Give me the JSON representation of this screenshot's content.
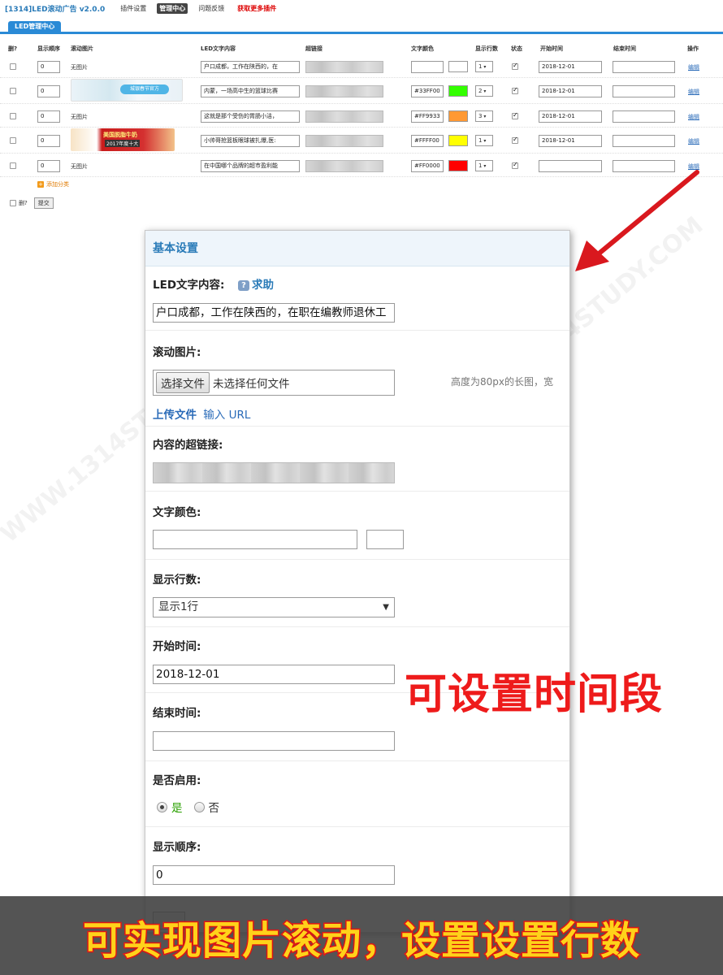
{
  "header": {
    "app_title": "[1314]LED滚动广告 v2.0.0",
    "nav": [
      "插件设置",
      "管理中心",
      "问题反馈",
      "获取更多插件"
    ]
  },
  "tab": {
    "label": "LED管理中心"
  },
  "table": {
    "columns": [
      "删?",
      "显示顺序",
      "滚动图片",
      "LED文字内容",
      "超链接",
      "文字颜色",
      "显示行数",
      "状态",
      "开始时间",
      "结束时间",
      "操作"
    ],
    "rows": [
      {
        "order": "0",
        "image": "无图片",
        "text": "户口成都，工作在陕西的，在",
        "color": "",
        "swatch": "#ffffff",
        "lines": "1",
        "enabled": true,
        "start": "2018-12-01",
        "end": "",
        "action": "编辑"
      },
      {
        "order": "0",
        "image": "banner-1",
        "text": "内蒙，一场高中生的篮球比赛",
        "color": "#33FF00",
        "swatch": "#33ff00",
        "lines": "2",
        "enabled": true,
        "start": "2018-12-01",
        "end": "",
        "action": "编辑"
      },
      {
        "order": "0",
        "image": "无图片",
        "text": "这就是那个受伤的胃肠小洁，",
        "color": "#FF9933",
        "swatch": "#ff9933",
        "lines": "3",
        "enabled": true,
        "start": "2018-12-01",
        "end": "",
        "action": "编辑"
      },
      {
        "order": "0",
        "image": "banner-2",
        "text": "小帅哥抢篮板眼球被扎爆,医:",
        "color": "#FFFF00",
        "swatch": "#ffff00",
        "lines": "1",
        "enabled": true,
        "start": "2018-12-01",
        "end": "",
        "action": "编辑"
      },
      {
        "order": "0",
        "image": "无图片",
        "text": "在中国哪个品牌的超市盈利能",
        "color": "#FF0000",
        "swatch": "#ff0000",
        "lines": "1",
        "enabled": true,
        "start": "",
        "end": "",
        "action": "编辑"
      }
    ],
    "banner1_text": "城银春节官方",
    "banner2_text_1": "美国脱脂牛奶",
    "banner2_text_2": "2017年度十大",
    "add_category": "添加分类",
    "footer_delete": "删?",
    "submit": "提交"
  },
  "modal": {
    "title": "基本设置",
    "led_text_label": "LED文字内容:",
    "help": "求助",
    "led_text_value": "户口成都，工作在陕西的，在职在编教师退休工",
    "image_label": "滚动图片:",
    "choose_file": "选择文件",
    "no_file": "未选择任何文件",
    "image_hint": "高度为80px的长图，宽",
    "upload_link": "上传文件",
    "url_link": "输入 URL",
    "link_label": "内容的超链接:",
    "color_label": "文字颜色:",
    "lines_label": "显示行数:",
    "lines_value": "显示1行",
    "start_label": "开始时间:",
    "start_value": "2018-12-01",
    "end_label": "结束时间:",
    "enable_label": "是否启用:",
    "yes": "是",
    "no": "否",
    "order_label": "显示顺序:",
    "order_value": "0"
  },
  "overlay": {
    "caption_time": "可设置时间段",
    "caption_bottom": "可实现图片滚动，设置设置行数",
    "arrow_color": "#d9181e"
  }
}
